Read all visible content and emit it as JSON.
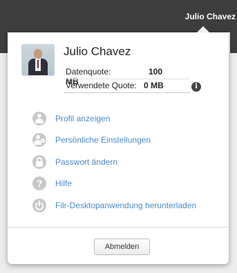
{
  "topbar": {
    "user_name": "Julio Chavez"
  },
  "profile": {
    "name": "Julio Chavez",
    "quota_label": "Datenquote:",
    "quota_value": "100 MB",
    "used_label": "Verwendete Quote:",
    "used_value": "0 MB",
    "info_icon": "i"
  },
  "menu": [
    {
      "label": "Profil anzeigen",
      "icon": "user-icon"
    },
    {
      "label": "Persönliche Einstellungen",
      "icon": "user-settings-icon"
    },
    {
      "label": "Passwort ändern",
      "icon": "lock-icon"
    },
    {
      "label": "Hilfe",
      "icon": "help-icon",
      "glyph": "?"
    },
    {
      "label": "Filr-Desktopanwendung herunterladen",
      "icon": "power-icon"
    }
  ],
  "logout_label": "Abmelden",
  "colors": {
    "topbar": "#3d3d3d",
    "link": "#4a8ac9",
    "icon_bg": "#c8c8c8"
  }
}
